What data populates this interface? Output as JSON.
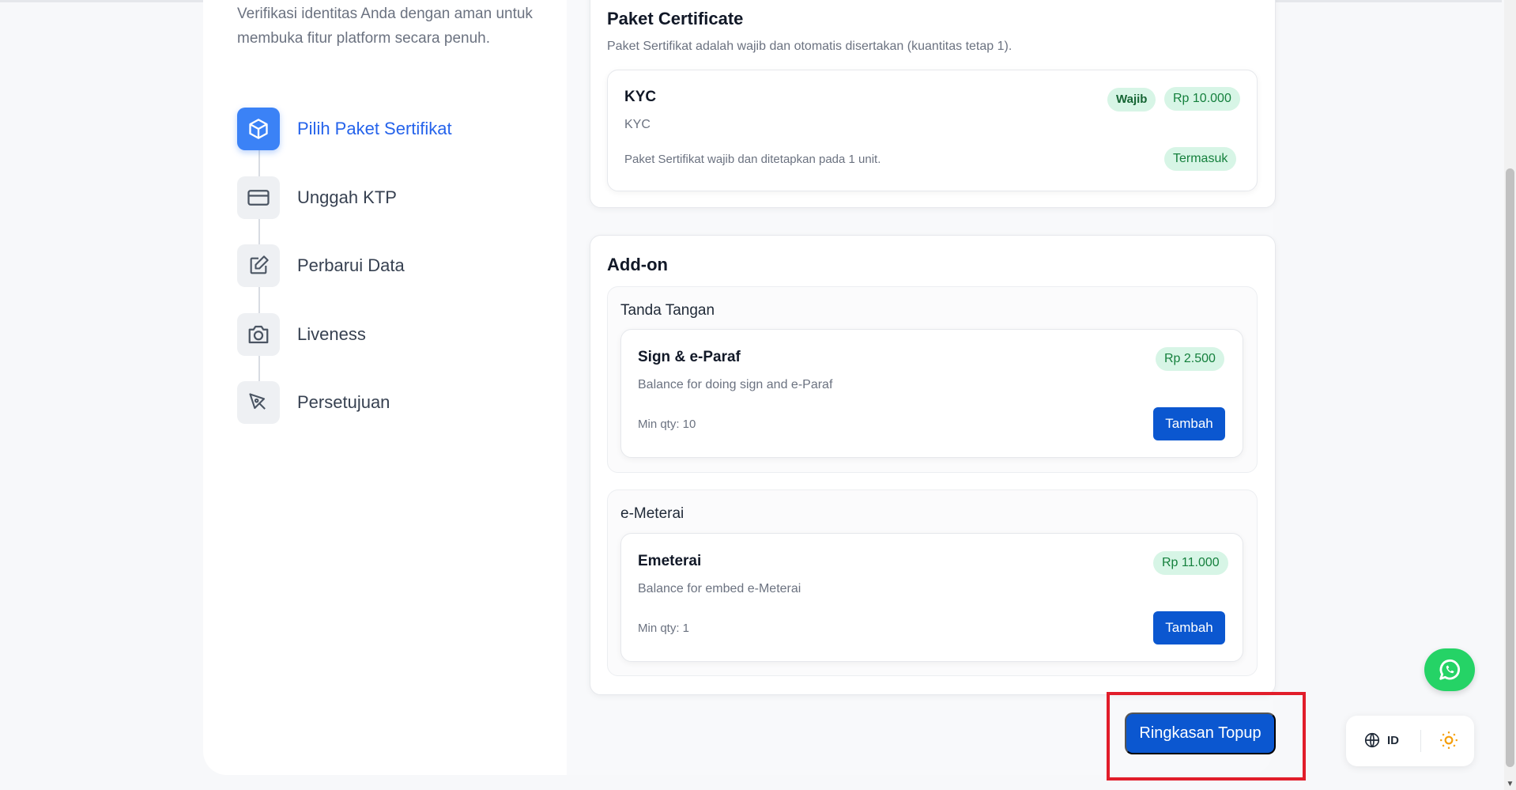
{
  "intro": {
    "text": "Verifikasi identitas Anda dengan aman untuk membuka fitur platform secara penuh."
  },
  "steps": [
    {
      "label": "Pilih Paket Sertifikat",
      "icon": "cube-icon",
      "active": true
    },
    {
      "label": "Unggah KTP",
      "icon": "id-card-icon",
      "active": false
    },
    {
      "label": "Perbarui Data",
      "icon": "edit-icon",
      "active": false
    },
    {
      "label": "Liveness",
      "icon": "camera-icon",
      "active": false
    },
    {
      "label": "Persetujuan",
      "icon": "pen-nib-icon",
      "active": false
    }
  ],
  "package": {
    "title": "Paket Certificate",
    "subtitle": "Paket Sertifikat adalah wajib dan otomatis disertakan (kuantitas tetap 1).",
    "item": {
      "name": "KYC",
      "description": "KYC",
      "required_badge": "Wajib",
      "price": "Rp 10.000",
      "note": "Paket Sertifikat wajib dan ditetapkan pada 1 unit.",
      "status": "Termasuk"
    }
  },
  "addon": {
    "title": "Add-on",
    "groups": [
      {
        "title": "Tanda Tangan",
        "item": {
          "name": "Sign & e-Paraf",
          "description": "Balance for doing sign and e-Paraf",
          "price": "Rp 2.500",
          "min_qty": "Min qty: 10",
          "button": "Tambah"
        }
      },
      {
        "title": "e-Meterai",
        "item": {
          "name": "Emeterai",
          "description": "Balance for embed e-Meterai",
          "price": "Rp 11.000",
          "min_qty": "Min qty: 1",
          "button": "Tambah"
        }
      }
    ]
  },
  "summary_button": "Ringkasan Topup",
  "toolbar": {
    "language": "ID"
  },
  "colors": {
    "accent": "#0b57d0",
    "active_step": "#3b82f6",
    "badge_bg": "#d7f5e6",
    "highlight": "#e11d2a",
    "whatsapp": "#25d366"
  }
}
